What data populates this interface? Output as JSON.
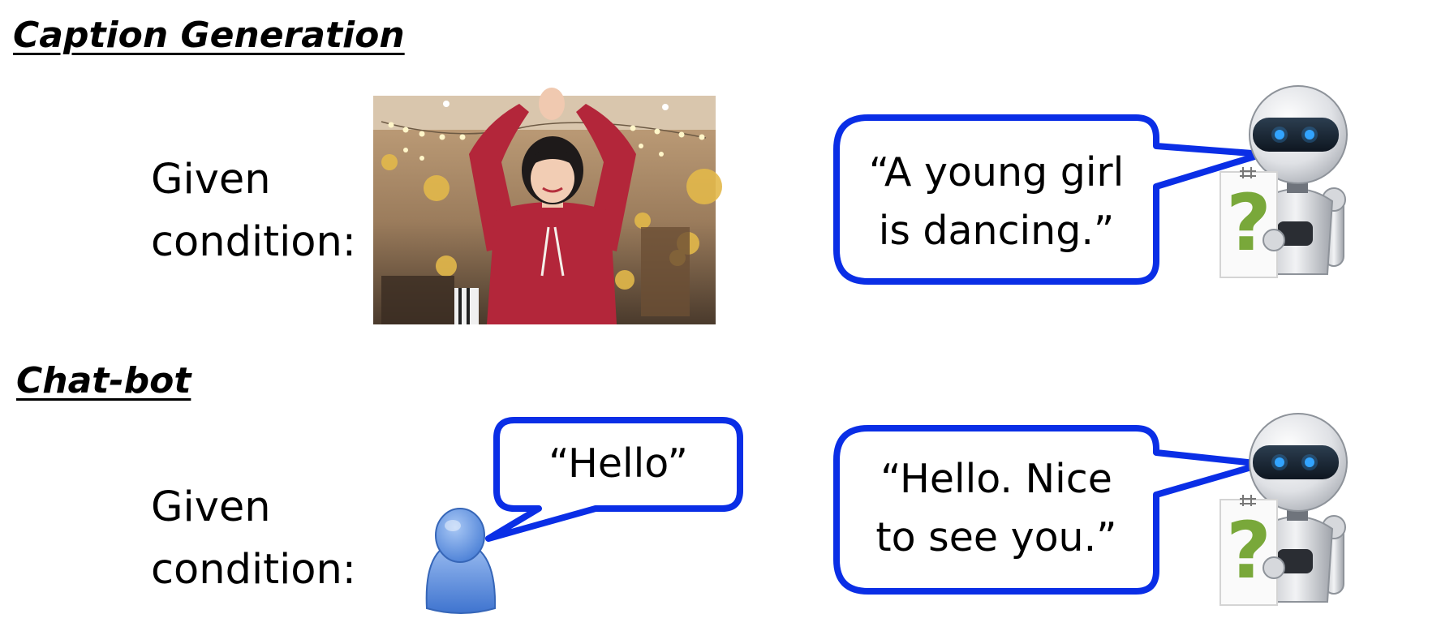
{
  "caption_section": {
    "title": "Caption Generation",
    "condition_line1": "Given",
    "condition_line2": "condition:",
    "robot_reply_line1": "“A young girl",
    "robot_reply_line2": "is dancing.”",
    "robot_sign": "?"
  },
  "chatbot_section": {
    "title": "Chat-bot",
    "condition_line1": "Given",
    "condition_line2": "condition:",
    "user_says": "“Hello”",
    "robot_reply_line1": "“Hello. Nice",
    "robot_reply_line2": "to see you.”",
    "robot_sign": "?"
  },
  "colors": {
    "bubble_border": "#0a2ee6",
    "user_icon": "#5b8fe0",
    "sign_question_mark": "#79a83a"
  },
  "icons": [
    "dancing-girl-photo",
    "user-icon",
    "robot-icon"
  ]
}
